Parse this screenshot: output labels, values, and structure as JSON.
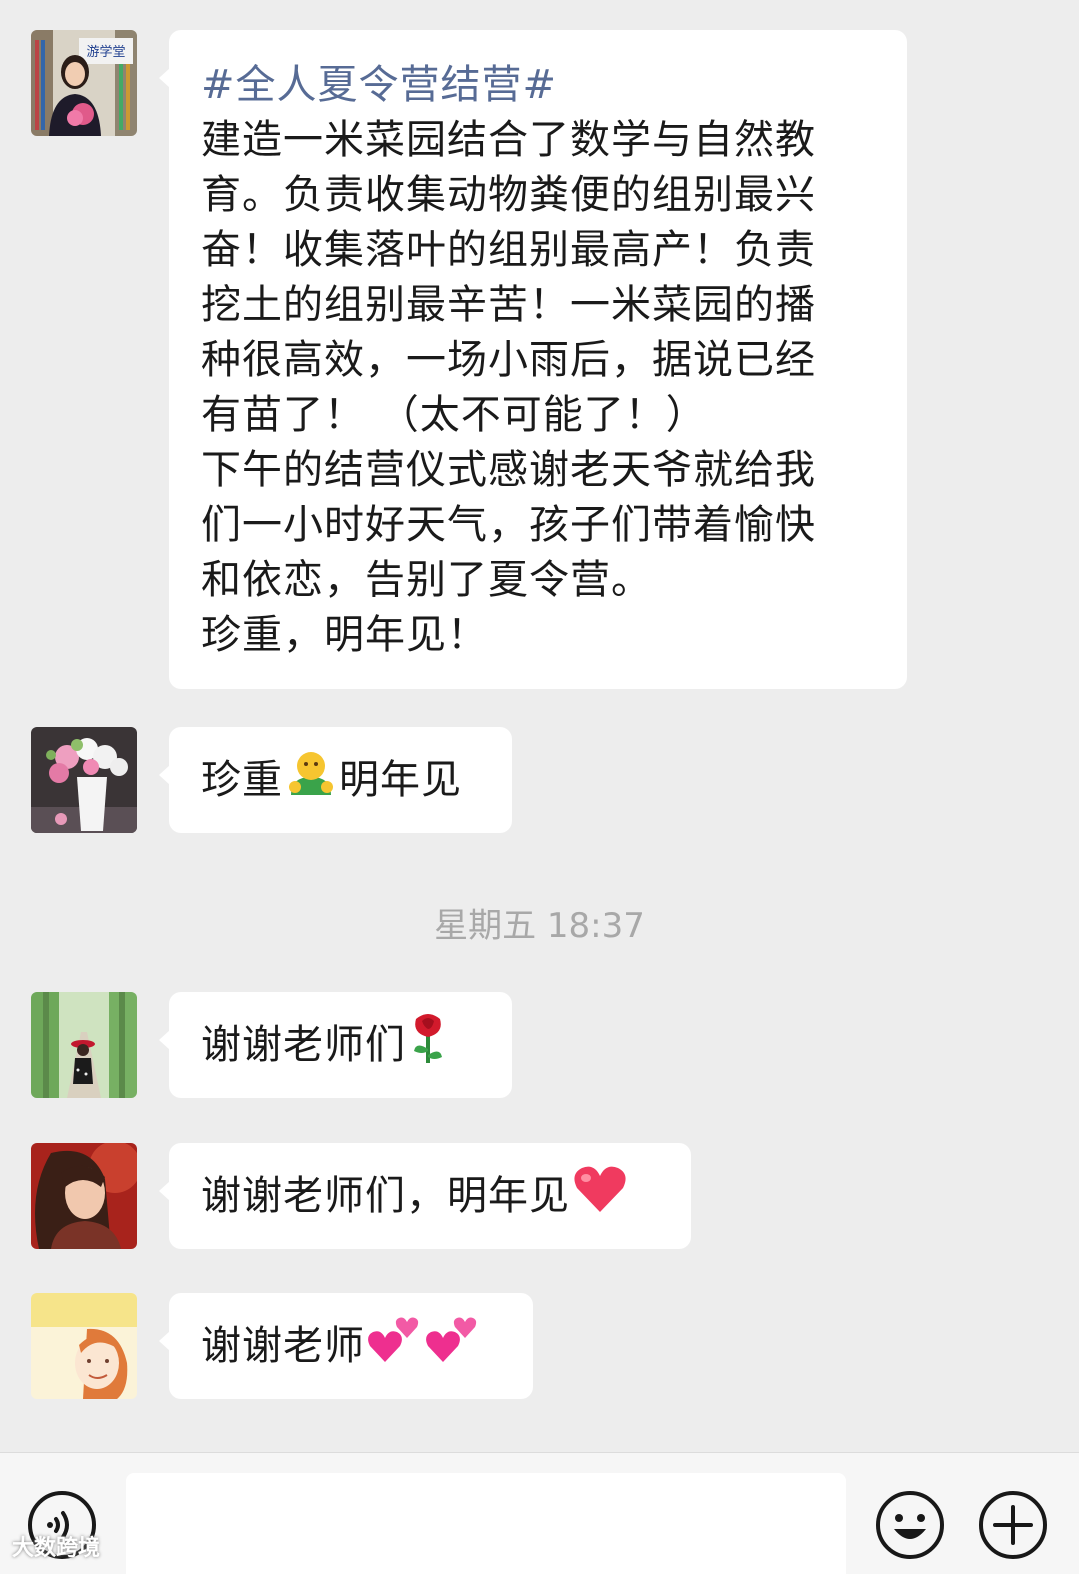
{
  "messages": [
    {
      "lines": [
        "#全人夏令营结营#",
        "建造一米菜园结合了数学与自然教",
        "育。负责收集动物粪便的组别最兴",
        "奋！收集落叶的组别最高产！负责",
        "挖土的组别最辛苦！一米菜园的播",
        "种很高效，一场小雨后，据说已经",
        "有苗了！ （太不可能了！）",
        "下午的结营仪式感谢老天爷就给我",
        "们一小时好天气，孩子们带着愉快",
        "和依恋，告别了夏令营。",
        "珍重，明年见！"
      ],
      "avatar_label": "游学堂"
    },
    {
      "text_before": "珍重",
      "emoji": "person-emoji",
      "text_after": "明年见"
    },
    {
      "text": "谢谢老师们",
      "emoji": "rose-emoji"
    },
    {
      "text": "谢谢老师们，明年见",
      "emoji": "heart-emoji"
    },
    {
      "text": "谢谢老师",
      "emoji": "two-hearts-emoji"
    }
  ],
  "timestamp": "星期五 18:37",
  "watermark": "大数跨境",
  "colors": {
    "background": "#ededed",
    "bubble": "#ffffff",
    "topic": "#576b95",
    "timestamp": "#a8a8a8"
  }
}
